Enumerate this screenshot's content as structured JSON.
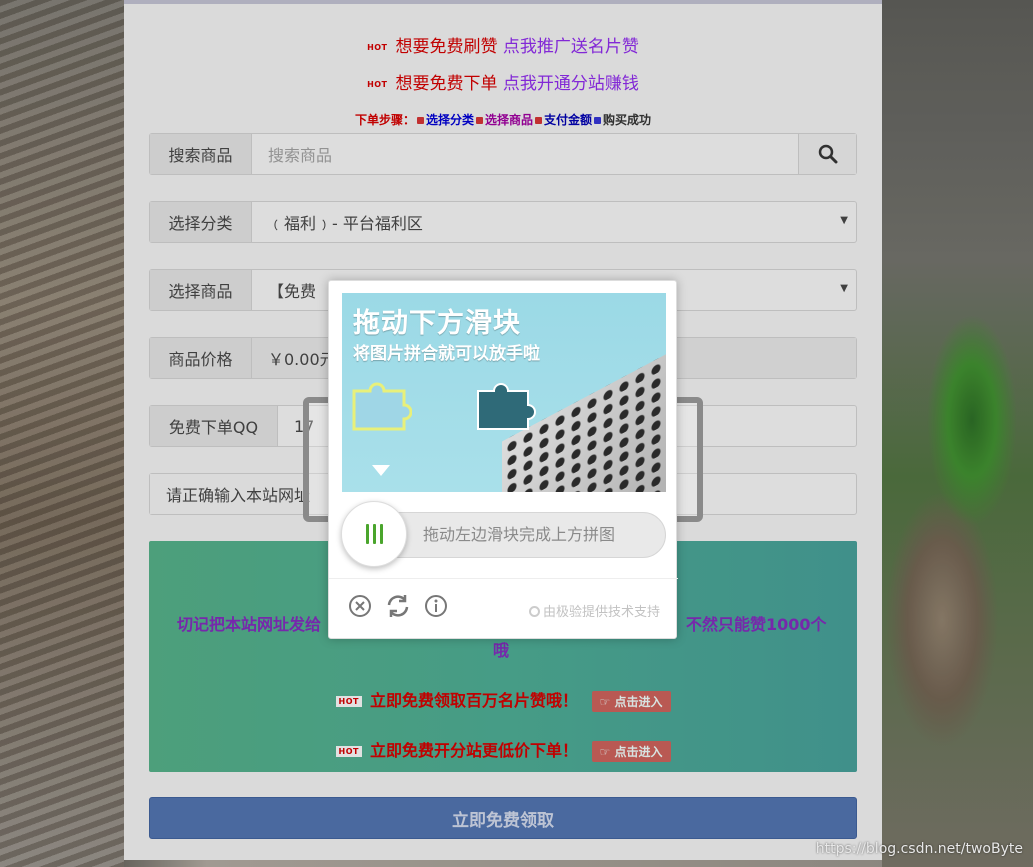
{
  "hot_lines": [
    {
      "tag": "HOT",
      "text": "想要免费刷赞",
      "link": "点我推广送名片赞"
    },
    {
      "tag": "HOT",
      "text": "想要免费下单",
      "link": "点我开通分站赚钱"
    }
  ],
  "steps": {
    "label": "下单步骤：",
    "step1": "选择分类",
    "step2": "选择商品",
    "step3": "支付金额",
    "step4": "购买成功"
  },
  "form": {
    "search": {
      "label": "搜索商品",
      "placeholder": "搜索商品"
    },
    "category": {
      "label": "选择分类",
      "value": "﹙福利﹚- 平台福利区"
    },
    "product": {
      "label": "选择商品",
      "value": "【免费"
    },
    "price": {
      "label": "商品价格",
      "value": "￥0.00元"
    },
    "qq": {
      "label": "免费下单QQ",
      "value": "17"
    },
    "site": {
      "label": "请正确输入本站网址"
    }
  },
  "notice": {
    "left": "切记把本站网址发给",
    "right": "不然只能赞1000个",
    "tail": "哦"
  },
  "promos": [
    {
      "tag": "HOT",
      "text": "立即免费领取百万名片赞哦！",
      "button": "点击进入"
    },
    {
      "tag": "HOT",
      "text": "立即免费开分站更低价下单！",
      "button": "点击进入"
    }
  ],
  "submit_label": "立即免费领取",
  "captcha": {
    "title": "拖动下方滑块",
    "subtitle": "将图片拼合就可以放手啦",
    "slider_hint": "拖动左边滑块完成上方拼图",
    "credit": "由极验提供技术支持"
  },
  "watermark": "https://blog.csdn.net/twoByte",
  "colors": {
    "accent_red": "#cc0000",
    "accent_purple": "#8a2be2",
    "submit": "#4f6fa8",
    "slider_green": "#4aa52c"
  }
}
